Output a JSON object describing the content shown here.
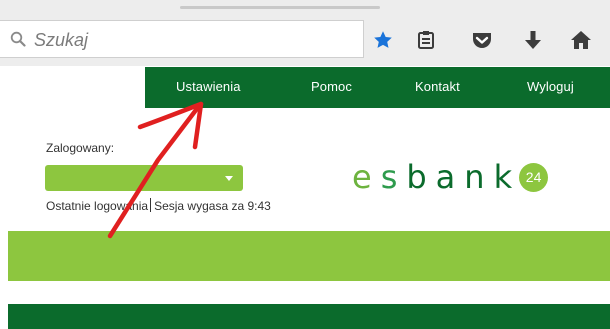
{
  "browser": {
    "search": {
      "placeholder": "Szukaj"
    },
    "icons": [
      "bookmark-star-icon",
      "reading-list-icon",
      "pocket-icon",
      "download-icon",
      "home-icon"
    ]
  },
  "nav": {
    "items": [
      {
        "label": "Ustawienia"
      },
      {
        "label": "Pomoc"
      },
      {
        "label": "Kontakt"
      },
      {
        "label": "Wyloguj"
      }
    ]
  },
  "login": {
    "label": "Zalogowany:",
    "account_value": "",
    "last_logins": "Ostatnie logowania",
    "session": "Sesja wygasa za 9:43"
  },
  "logo": {
    "text_e": "e",
    "text_s": "s",
    "text_rest": "bank",
    "badge": "24"
  },
  "colors": {
    "nav_bg": "#0b6b2c",
    "accent_green": "#8dc63f",
    "annotation_arrow": "#e02020"
  }
}
